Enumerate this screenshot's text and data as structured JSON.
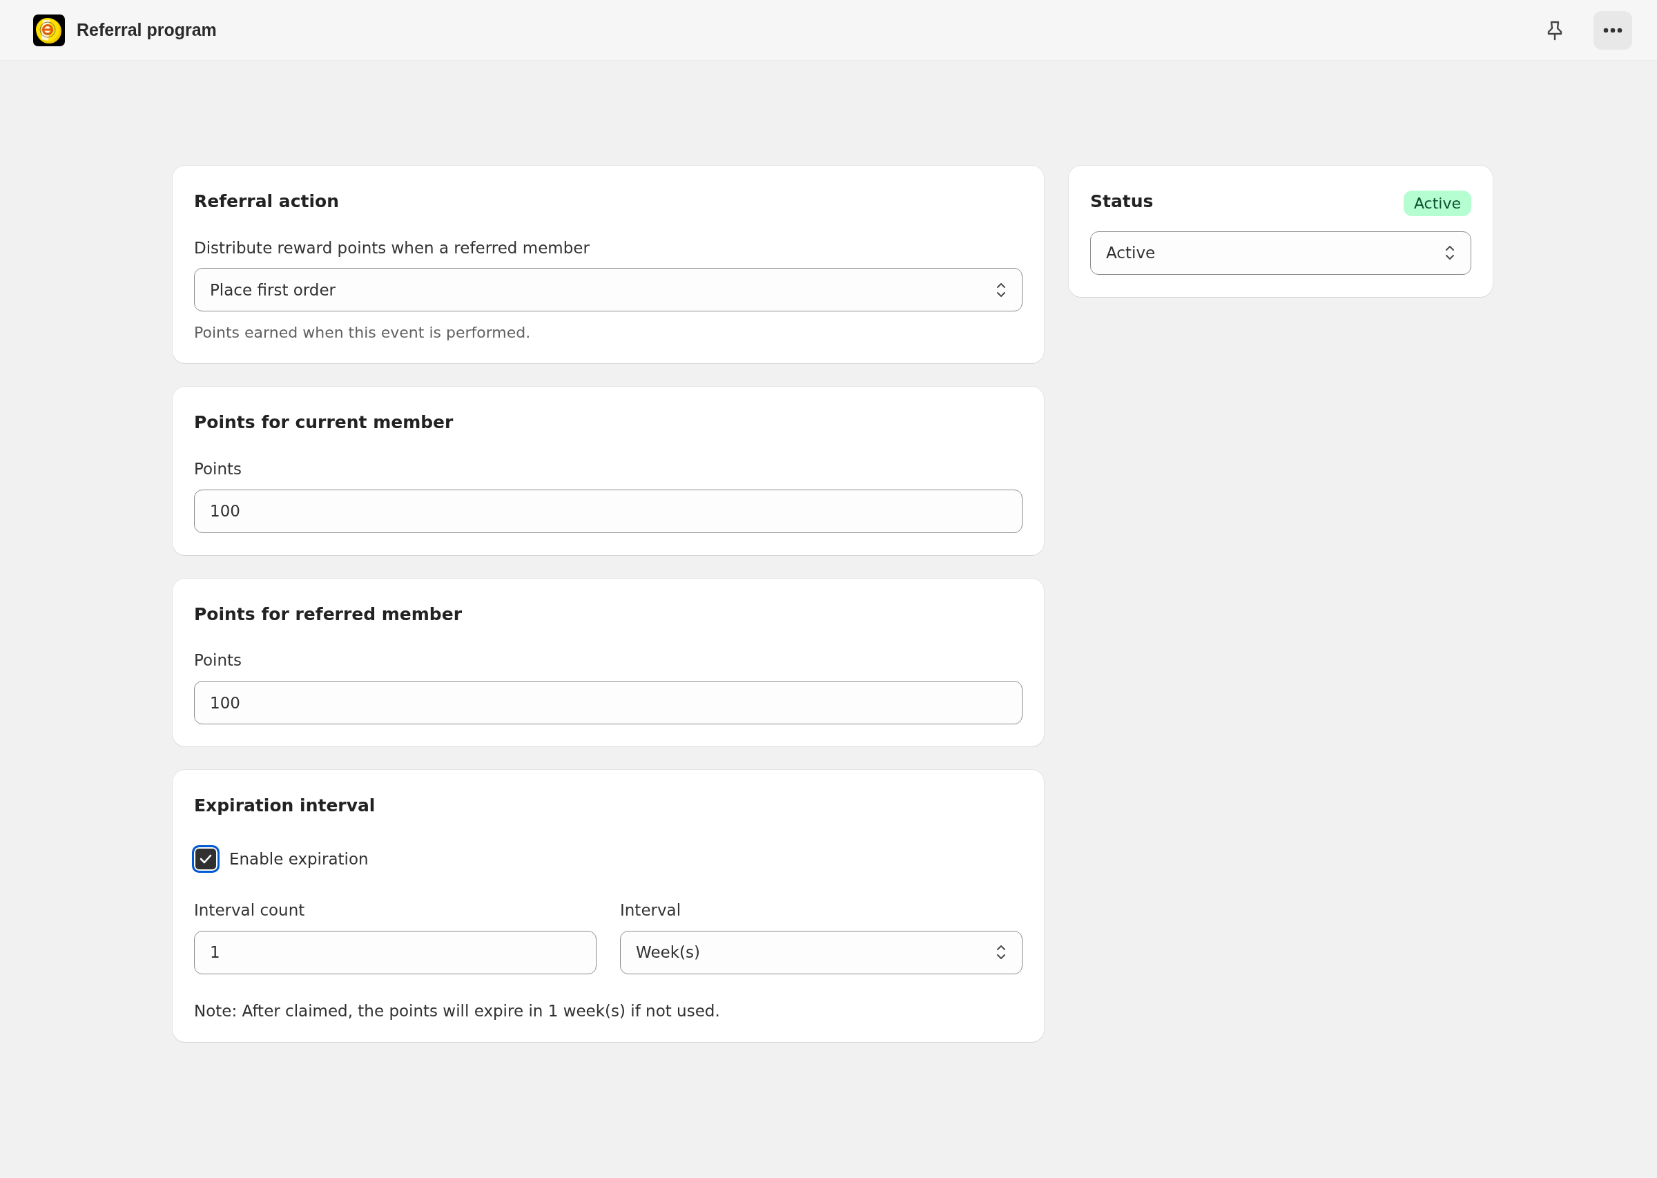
{
  "app_bar": {
    "title": "Referral program"
  },
  "referral_action": {
    "title": "Referral action",
    "label": "Distribute reward points when a referred member",
    "value": "Place first order",
    "help": "Points earned when this event is performed."
  },
  "current_member": {
    "title": "Points for current member",
    "label": "Points",
    "value": "100"
  },
  "referred_member": {
    "title": "Points for referred member",
    "label": "Points",
    "value": "100"
  },
  "expiration": {
    "title": "Expiration interval",
    "enable": {
      "label": "Enable expiration",
      "checked": true
    },
    "count": {
      "label": "Interval count",
      "value": "1"
    },
    "interval": {
      "label": "Interval",
      "value": "Week(s)"
    },
    "note": "Note: After claimed, the points will expire in 1 week(s) if not used."
  },
  "status": {
    "title": "Status",
    "badge": "Active",
    "value": "Active"
  }
}
